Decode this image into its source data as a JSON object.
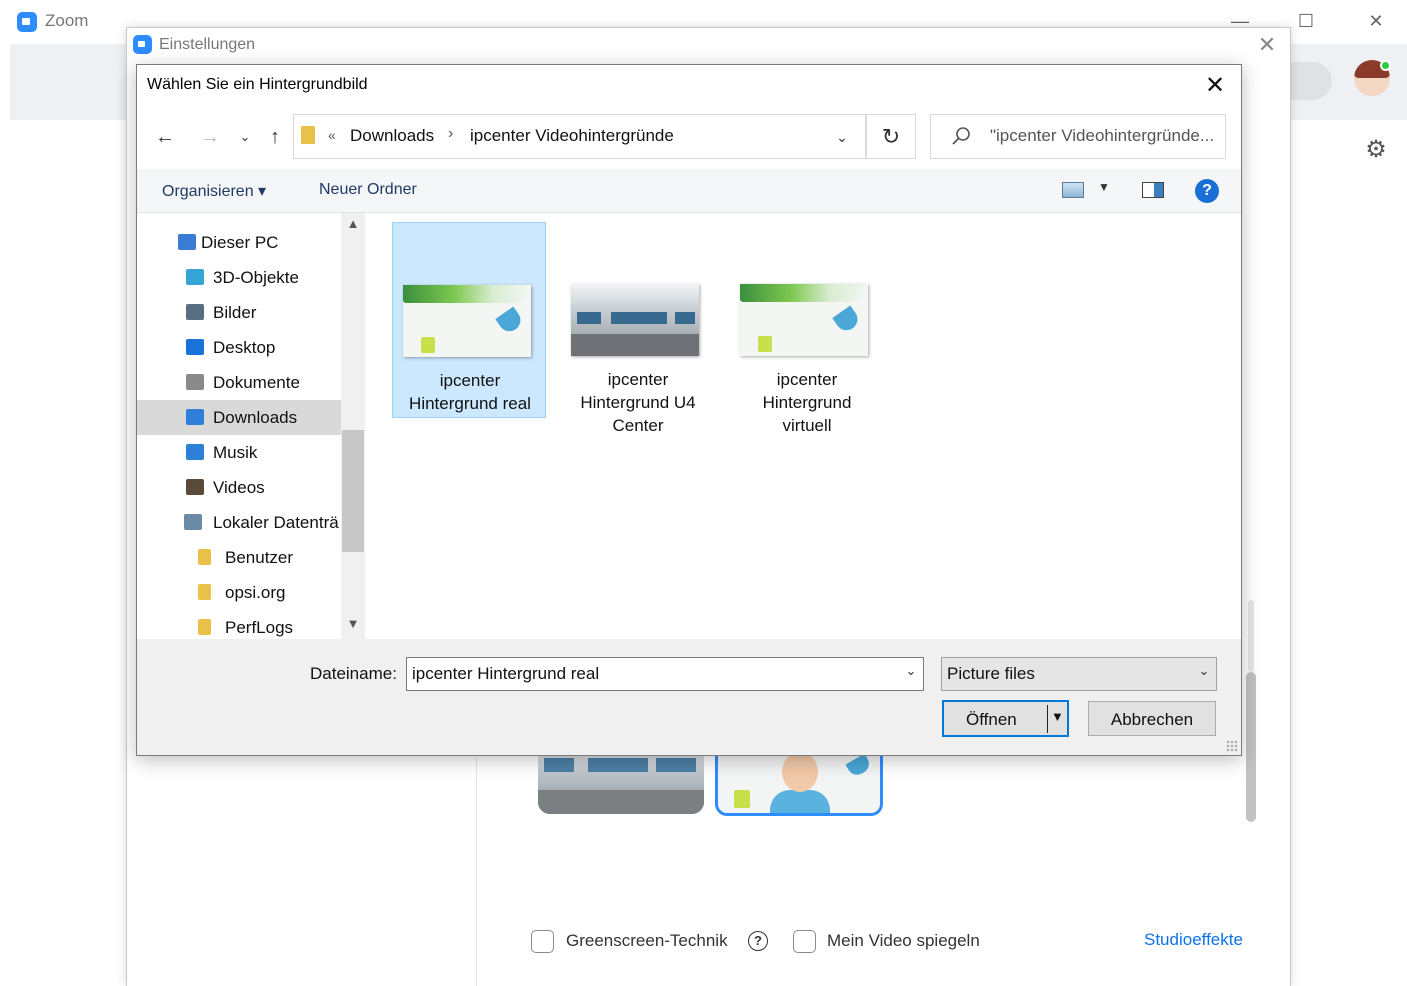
{
  "zoom_window": {
    "title": "Zoom",
    "brand_color": "#2D8CFF"
  },
  "settings_window": {
    "title": "Einstellungen",
    "options": {
      "greenscreen_label": "Greenscreen-Technik",
      "mirror_label": "Mein Video spiegeln",
      "studio_link": "Studioeffekte"
    }
  },
  "dialog": {
    "title": "Wählen Sie ein Hintergrundbild",
    "address": {
      "overflow": "«",
      "segments": [
        "Downloads",
        "ipcenter Videohintergründe"
      ],
      "separator": "›"
    },
    "search_placeholder": "\"ipcenter Videohintergründe...",
    "toolbar": {
      "organize": "Organisieren ▾",
      "new_folder": "Neuer Ordner",
      "help": "?"
    },
    "nav": [
      {
        "label": "Dieser PC",
        "icon": "computer-icon",
        "color": "#3a7bd5"
      },
      {
        "label": "3D-Objekte",
        "icon": "cube-icon",
        "color": "#35a5d8"
      },
      {
        "label": "Bilder",
        "icon": "pictures-icon",
        "color": "#5a6e82"
      },
      {
        "label": "Desktop",
        "icon": "desktop-icon",
        "color": "#1a73d9"
      },
      {
        "label": "Dokumente",
        "icon": "documents-icon",
        "color": "#8a8a8a"
      },
      {
        "label": "Downloads",
        "icon": "download-icon",
        "color": "#2f7fd8",
        "selected": true
      },
      {
        "label": "Musik",
        "icon": "music-icon",
        "color": "#2d7fd8"
      },
      {
        "label": "Videos",
        "icon": "video-icon",
        "color": "#5a4a3a"
      },
      {
        "label": "Lokaler Datenträ",
        "icon": "drive-icon",
        "color": "#6b8aa6"
      },
      {
        "label": "Benutzer",
        "icon": "folder-icon",
        "color": "#e9c148"
      },
      {
        "label": "opsi.org",
        "icon": "folder-icon",
        "color": "#e9c148"
      },
      {
        "label": "PerfLogs",
        "icon": "folder-icon",
        "color": "#e9c148"
      }
    ],
    "files": [
      {
        "line1": "ipcenter",
        "line2": "Hintergrund real",
        "line3": "",
        "selected": true
      },
      {
        "line1": "ipcenter",
        "line2": "Hintergrund U4",
        "line3": "Center",
        "selected": false
      },
      {
        "line1": "ipcenter",
        "line2": "Hintergrund",
        "line3": "virtuell",
        "selected": false
      }
    ],
    "filename_label": "Dateiname:",
    "filename_value": "ipcenter Hintergrund real",
    "filetype": "Picture files",
    "open_button": "Öffnen",
    "cancel_button": "Abbrechen"
  }
}
